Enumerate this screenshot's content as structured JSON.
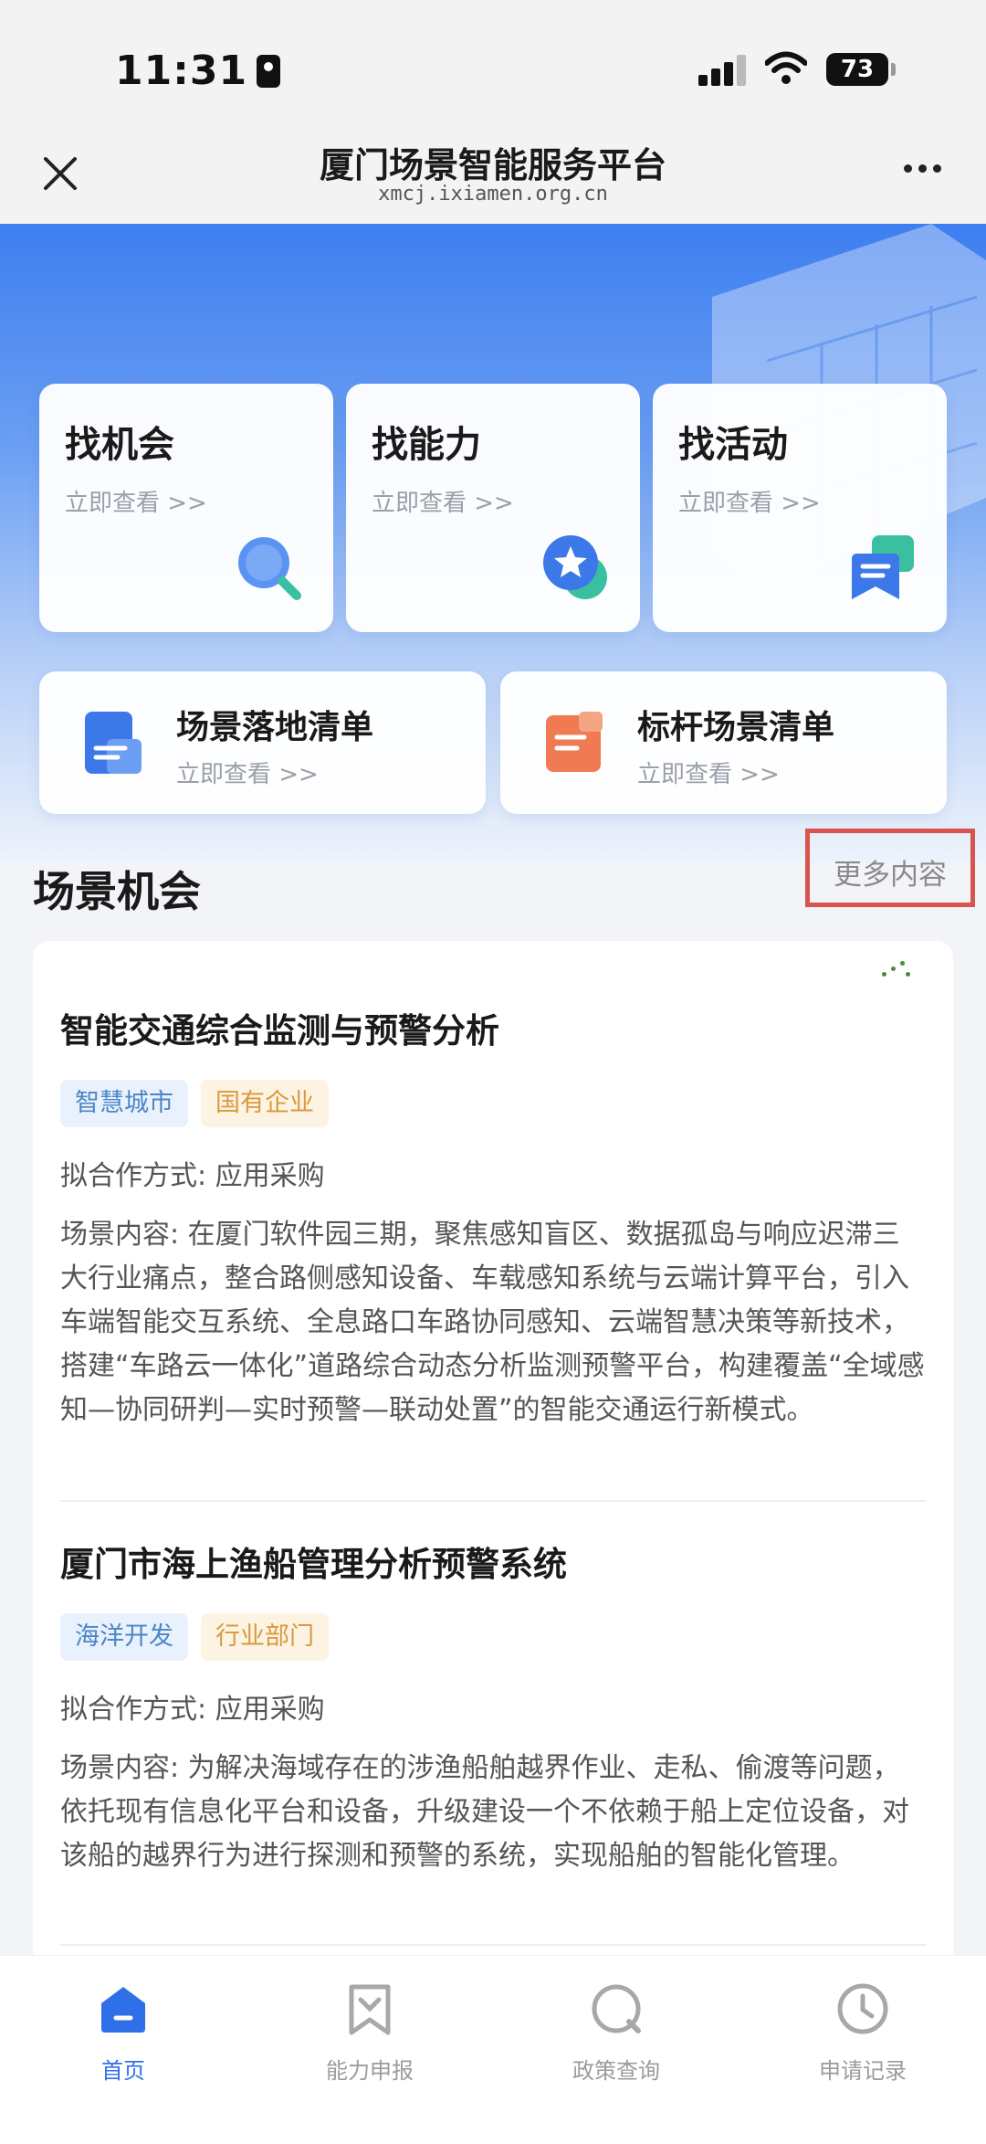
{
  "status_bar": {
    "time": "11:31",
    "battery": "73"
  },
  "nav": {
    "title": "厦门场景智能服务平台",
    "url": "xmcj.ixiamen.org.cn"
  },
  "quick_cards": [
    {
      "title": "找机会",
      "sub": "立即查看 >>"
    },
    {
      "title": "找能力",
      "sub": "立即查看 >>"
    },
    {
      "title": "找活动",
      "sub": "立即查看 >>"
    }
  ],
  "wide_cards": [
    {
      "title": "场景落地清单",
      "sub": "立即查看 >>"
    },
    {
      "title": "标杆场景清单",
      "sub": "立即查看 >>"
    }
  ],
  "section": {
    "title": "场景机会",
    "more": "更多内容"
  },
  "items": [
    {
      "title": "智能交通综合监测与预警分析",
      "tags": [
        "智慧城市",
        "国有企业"
      ],
      "mode": "拟合作方式: 应用采购",
      "desc": "场景内容: 在厦门软件园三期，聚焦感知盲区、数据孤岛与响应迟滞三大行业痛点，整合路侧感知设备、车载感知系统与云端计算平台，引入车端智能交互系统、全息路口车路协同感知、云端智慧决策等新技术，搭建“车路云一体化”道路综合动态分析监测预警平台，构建覆盖“全域感知—协同研判—实时预警—联动处置”的智能交通运行新模式。"
    },
    {
      "title": "厦门市海上渔船管理分析预警系统",
      "tags": [
        "海洋开发",
        "行业部门"
      ],
      "mode": "拟合作方式: 应用采购",
      "desc": "场景内容: 为解决海域存在的涉渔船舶越界作业、走私、偷渡等问题，依托现有信息化平台和设备，升级建设一个不依赖于船上定位设备，对该船的越界行为进行探测和预警的系统，实现船舶的智能化管理。"
    }
  ],
  "tabbar": [
    {
      "label": "首页",
      "icon": "home-icon"
    },
    {
      "label": "能力申报",
      "icon": "bookmark-icon"
    },
    {
      "label": "政策查询",
      "icon": "search-icon"
    },
    {
      "label": "申请记录",
      "icon": "clock-icon"
    }
  ],
  "colors": {
    "primary": "#2f6fe8",
    "highlight_box": "#d9534f",
    "tag_blue": "#4a86c8",
    "tag_orange": "#d89a3c"
  }
}
